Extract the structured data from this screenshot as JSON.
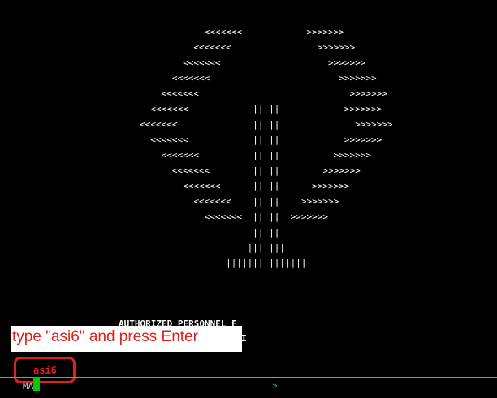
{
  "terminal": {
    "ascii_art": [
      "                                      <<<<<<<            >>>>>>>",
      "                                    <<<<<<<                >>>>>>>",
      "                                  <<<<<<<                    >>>>>>>",
      "                                <<<<<<<                        >>>>>>>",
      "                              <<<<<<<                            >>>>>>>",
      "                            <<<<<<<            || ||            >>>>>>>",
      "                          <<<<<<<              || ||              >>>>>>>",
      "                            <<<<<<<            || ||            >>>>>>>",
      "                              <<<<<<<          || ||          >>>>>>>",
      "                                <<<<<<<        || ||        >>>>>>>",
      "                                  <<<<<<<      || ||      >>>>>>>",
      "                                    <<<<<<<    || ||    >>>>>>>",
      "                                      <<<<<<<  || ||  >>>>>>>",
      "                                               || ||",
      "                                              ||| |||",
      "                                          ||||||| |||||||"
    ],
    "banner_line_1": "AUTHORIZED PERSONNEL F",
    "banner_line_2": "I",
    "typed_text": "asi6",
    "bottom_label": "MA",
    "arrow_glyph": "»"
  },
  "instruction": {
    "text": "type \"asi6\" and press Enter"
  },
  "colors": {
    "background": "#000000",
    "text": "#ffffff",
    "annotation_red": "#e0201a",
    "cursor_green": "#00c800",
    "rule_green": "#2bd92b"
  }
}
